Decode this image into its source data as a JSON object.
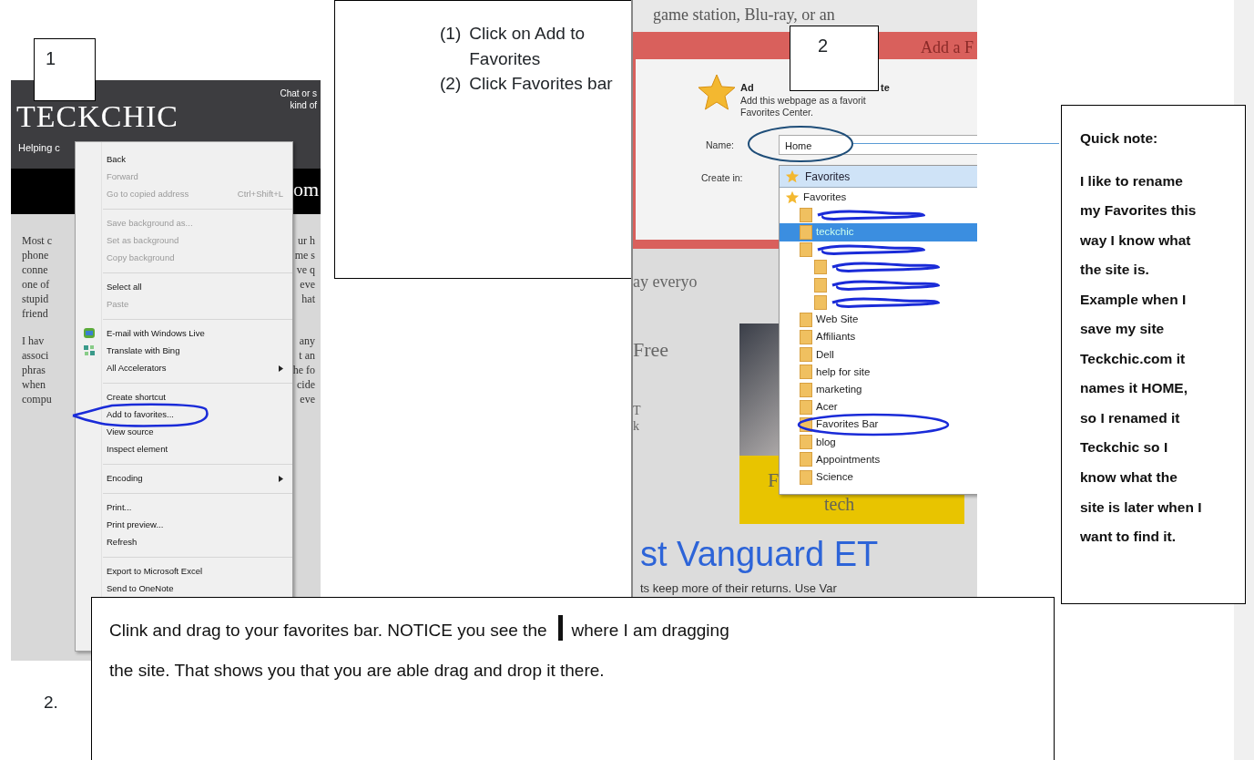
{
  "step_one": {
    "number": "1",
    "site": {
      "logo": "TECKCHIC",
      "tagline_right": [
        "Chat or s",
        "kind of"
      ],
      "tagline_left": "Helping c",
      "banner_text": "om",
      "paragraphs": [
        [
          {
            "left": "Most c",
            "right": "ur h"
          },
          {
            "left": "phone",
            "right": "me s"
          },
          {
            "left": "conne",
            "right": "ve q"
          },
          {
            "left": "one of",
            "right": "eve"
          },
          {
            "left": "stupid",
            "right": "hat"
          },
          {
            "left": "friend"
          }
        ],
        [
          {
            "left": "I hav",
            "right": "any"
          },
          {
            "left": "associ",
            "right": "t an"
          },
          {
            "left": "phras",
            "right": "he fo"
          },
          {
            "left": "when",
            "right": "cide"
          },
          {
            "left": "compu",
            "right": "eve"
          }
        ]
      ]
    },
    "context_menu": [
      [
        {
          "label": "Back",
          "kind": "plain",
          "disabled": false
        },
        {
          "label": "Forward",
          "kind": "plain",
          "disabled": true
        },
        {
          "label": "Go to copied address",
          "shortcut": "Ctrl+Shift+L",
          "kind": "plain",
          "disabled": true
        }
      ],
      [
        {
          "label": "Save background as...",
          "kind": "plain",
          "disabled": true
        },
        {
          "label": "Set as background",
          "kind": "plain",
          "disabled": true
        },
        {
          "label": "Copy background",
          "kind": "plain",
          "disabled": true
        }
      ],
      [
        {
          "label": "Select all",
          "kind": "plain",
          "disabled": false
        },
        {
          "label": "Paste",
          "kind": "plain",
          "disabled": true
        }
      ],
      [
        {
          "label": "E-mail with Windows Live",
          "kind": "mail",
          "disabled": false
        },
        {
          "label": "Translate with Bing",
          "kind": "translate",
          "disabled": false
        },
        {
          "label": "All Accelerators",
          "kind": "submenu",
          "disabled": false
        }
      ],
      [
        {
          "label": "Create shortcut",
          "kind": "plain",
          "disabled": false
        },
        {
          "label": "Add to favorites...",
          "kind": "plain",
          "disabled": false
        },
        {
          "label": "View source",
          "kind": "plain",
          "disabled": false
        },
        {
          "label": "Inspect element",
          "kind": "plain",
          "disabled": false
        }
      ],
      [
        {
          "label": "Encoding",
          "kind": "submenu",
          "disabled": false
        }
      ],
      [
        {
          "label": "Print...",
          "kind": "plain",
          "disabled": false
        },
        {
          "label": "Print preview...",
          "kind": "plain",
          "disabled": false
        },
        {
          "label": "Refresh",
          "kind": "plain",
          "disabled": false
        }
      ],
      [
        {
          "label": "Export to Microsoft Excel",
          "kind": "plain",
          "disabled": false
        },
        {
          "label": "Send to OneNote",
          "kind": "plain",
          "disabled": false
        }
      ]
    ]
  },
  "instructions": [
    {
      "marker": "(1)",
      "text": "Click on Add to Favorites"
    },
    {
      "marker": "(2)",
      "text": "Click Favorites bar"
    }
  ],
  "step_two": {
    "number": "2",
    "page_top_text": "game station, Blu-ray, or an",
    "dialog_title": "Add a F",
    "dialog_heading_parts": [
      "Ad",
      "te"
    ],
    "dialog_description": [
      "Add this webpage as a favorit",
      "Favorites Center."
    ],
    "name_label": "Name:",
    "name_value": "Home",
    "create_in_label": "Create in:",
    "create_in_value": "Favorites",
    "folders": [
      {
        "label": "Favorites",
        "kind": "star",
        "selected": false,
        "children": [
          {
            "kind": "scribbled",
            "selected": false
          },
          {
            "label": "teckchic",
            "kind": "folder",
            "selected": true
          },
          {
            "kind": "scribbled",
            "selected": false,
            "children": [
              {
                "kind": "scribbled",
                "selected": false
              },
              {
                "kind": "scribbled",
                "selected": false
              },
              {
                "kind": "scribbled",
                "selected": false
              }
            ]
          },
          {
            "label": "Web Site",
            "kind": "folder",
            "selected": false
          },
          {
            "label": "Affiliants",
            "kind": "folder",
            "selected": false
          },
          {
            "label": "Dell",
            "kind": "folder",
            "selected": false
          },
          {
            "label": "help for site",
            "kind": "folder",
            "selected": false
          },
          {
            "label": "marketing",
            "kind": "folder",
            "selected": false
          },
          {
            "label": "Acer",
            "kind": "folder",
            "selected": false
          },
          {
            "label": "Favorites Bar",
            "kind": "folder",
            "selected": false
          },
          {
            "label": "blog",
            "kind": "folder",
            "selected": false
          },
          {
            "label": "Appointments",
            "kind": "folder",
            "selected": false
          },
          {
            "label": "Science",
            "kind": "folder",
            "selected": false
          }
        ]
      }
    ],
    "page_texts": {
      "greeting": "ay everyo",
      "free": "Free",
      "letter_t": "T",
      "letter_k": "k",
      "banner_letter": "F",
      "banner_word": "tech",
      "ad_headline": "st Vanguard ET",
      "ad_text": "ts keep more of their returns. Use Var"
    }
  },
  "quick_note": {
    "heading": "Quick note:",
    "body": "I like to rename my Favorites this way I know what the site is. Example when I save my site Teckchic.com it names it HOME, so I renamed it Teckchic so I know what the site is later when I want to find it."
  },
  "bottom_note": {
    "number": "2.",
    "text_before": "Clink and drag to your favorites bar. NOTICE you see the",
    "text_after": "where I am dragging",
    "second_line": "the site. That shows you that you are able drag and drop it there."
  }
}
